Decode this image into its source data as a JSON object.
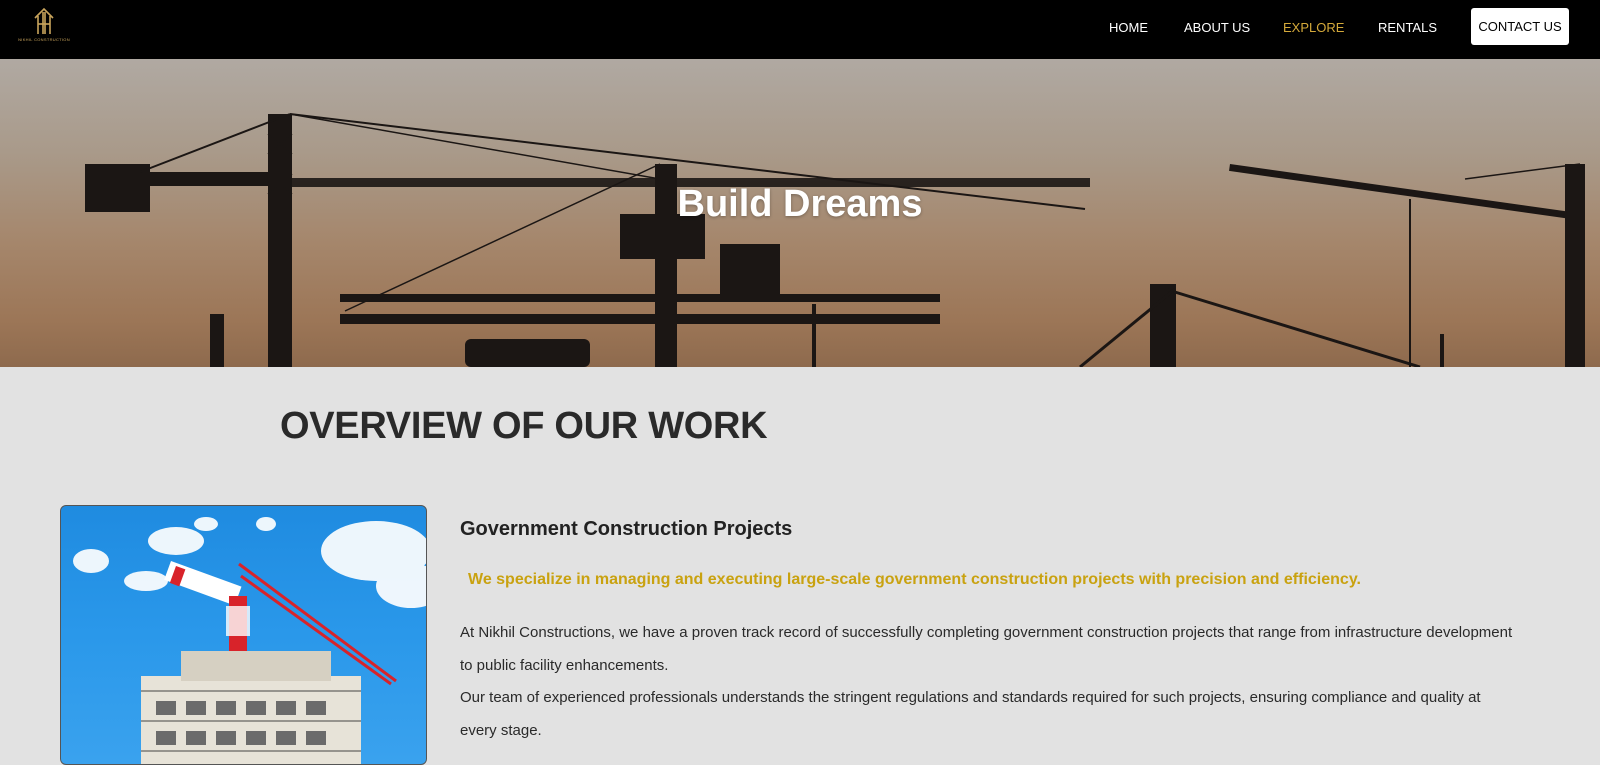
{
  "brand": {
    "logo_text": "NIKHIL CONSTRUCTION",
    "accent_color": "#c9a45c"
  },
  "nav": {
    "items": [
      {
        "label": "HOME"
      },
      {
        "label": "ABOUT US"
      },
      {
        "label": "EXPLORE",
        "active": true
      },
      {
        "label": "RENTALS"
      }
    ],
    "contact_label": "CONTACT US"
  },
  "hero": {
    "title": "Build Dreams"
  },
  "overview": {
    "title": "OVERVIEW OF OUR WORK",
    "project": {
      "heading": "Government Construction Projects",
      "tagline": "We specialize in managing and executing large-scale government construction projects with precision and efficiency.",
      "paragraph1": "At Nikhil Constructions, we have a proven track record of successfully completing government construction projects that range from infrastructure development to public facility enhancements.",
      "paragraph2": "Our team of experienced professionals understands the stringent regulations and standards required for such projects, ensuring compliance and quality at every stage."
    }
  },
  "colors": {
    "nav_bg": "#000000",
    "active_link": "#d4a93a",
    "tagline": "#c9a210",
    "page_bg": "#e2e2e2"
  }
}
